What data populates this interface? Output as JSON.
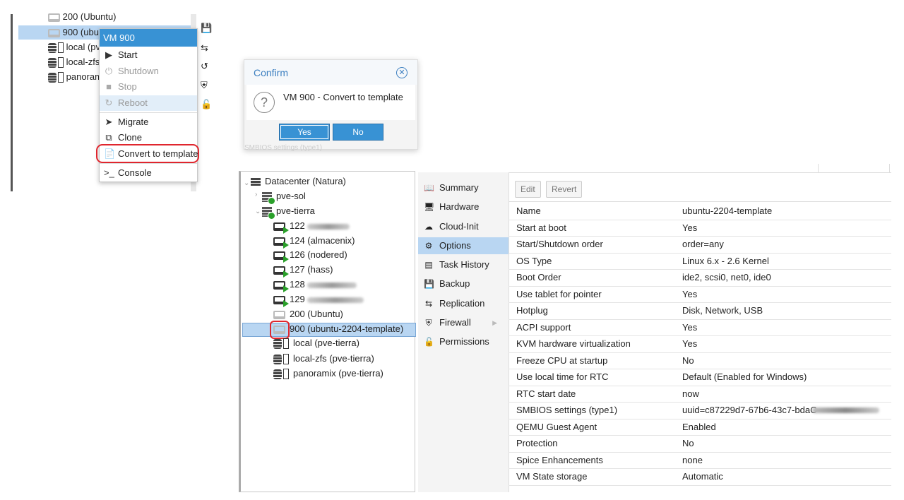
{
  "left_tree": {
    "items": [
      {
        "label": "200 (Ubuntu)"
      },
      {
        "label": "900 (ubu"
      },
      {
        "label": "local (pv"
      },
      {
        "label": "local-zfs"
      },
      {
        "label": "panoram"
      }
    ]
  },
  "context_menu": {
    "title": "VM 900",
    "items": [
      {
        "icon": "play-icon",
        "label": "Start"
      },
      {
        "icon": "power-icon",
        "label": "Shutdown"
      },
      {
        "icon": "stop-icon",
        "label": "Stop"
      },
      {
        "icon": "refresh-icon",
        "label": "Reboot"
      },
      {
        "icon": "send-icon",
        "label": "Migrate"
      },
      {
        "icon": "clone-icon",
        "label": "Clone"
      },
      {
        "icon": "file-icon",
        "label": "Convert to template"
      },
      {
        "icon": "terminal-icon",
        "label": "Console"
      }
    ]
  },
  "confirm_dialog": {
    "title": "Confirm",
    "message": "VM 900 - Convert to template",
    "yes_label": "Yes",
    "no_label": "No",
    "background_text": "SMBIOS settings (type1)"
  },
  "resource_tree": {
    "datacenter": "Datacenter (Natura)",
    "nodes": [
      {
        "label": "pve-sol"
      },
      {
        "label": "pve-tierra"
      }
    ],
    "vms": [
      {
        "label": "122"
      },
      {
        "label": "124 (almacenix)"
      },
      {
        "label": "126 (nodered)"
      },
      {
        "label": "127 (hass)"
      },
      {
        "label": "128"
      },
      {
        "label": "129"
      },
      {
        "label": "200 (Ubuntu)"
      },
      {
        "label": "900 (ubuntu-2204-template)"
      }
    ],
    "storage": [
      {
        "label": "local (pve-tierra)"
      },
      {
        "label": "local-zfs (pve-tierra)"
      },
      {
        "label": "panoramix (pve-tierra)"
      }
    ]
  },
  "nav": {
    "items": [
      {
        "icon": "book-icon",
        "label": "Summary"
      },
      {
        "icon": "monitor-icon",
        "label": "Hardware"
      },
      {
        "icon": "cloud-icon",
        "label": "Cloud-Init"
      },
      {
        "icon": "gear-icon",
        "label": "Options"
      },
      {
        "icon": "list-icon",
        "label": "Task History"
      },
      {
        "icon": "floppy-icon",
        "label": "Backup"
      },
      {
        "icon": "retweet-icon",
        "label": "Replication"
      },
      {
        "icon": "shield-icon",
        "label": "Firewall"
      },
      {
        "icon": "unlock-icon",
        "label": "Permissions"
      }
    ],
    "active": "Options"
  },
  "toolbar": {
    "edit_label": "Edit",
    "revert_label": "Revert"
  },
  "options": [
    {
      "key": "Name",
      "value": "ubuntu-2204-template"
    },
    {
      "key": "Start at boot",
      "value": "Yes"
    },
    {
      "key": "Start/Shutdown order",
      "value": "order=any"
    },
    {
      "key": "OS Type",
      "value": "Linux 6.x - 2.6 Kernel"
    },
    {
      "key": "Boot Order",
      "value": "ide2, scsi0, net0, ide0"
    },
    {
      "key": "Use tablet for pointer",
      "value": "Yes"
    },
    {
      "key": "Hotplug",
      "value": "Disk, Network, USB"
    },
    {
      "key": "ACPI support",
      "value": "Yes"
    },
    {
      "key": "KVM hardware virtualization",
      "value": "Yes"
    },
    {
      "key": "Freeze CPU at startup",
      "value": "No"
    },
    {
      "key": "Use local time for RTC",
      "value": "Default (Enabled for Windows)"
    },
    {
      "key": "RTC start date",
      "value": "now"
    },
    {
      "key": "SMBIOS settings (type1)",
      "value": "uuid=c87229d7-67b6-43c7-bdaC"
    },
    {
      "key": "QEMU Guest Agent",
      "value": "Enabled"
    },
    {
      "key": "Protection",
      "value": "No"
    },
    {
      "key": "Spice Enhancements",
      "value": "none"
    },
    {
      "key": "VM State storage",
      "value": "Automatic"
    }
  ],
  "colors": {
    "accent": "#3892d4",
    "selection": "#b9d6f2",
    "highlight_ring": "#e0262e",
    "running": "#2aa02a"
  }
}
